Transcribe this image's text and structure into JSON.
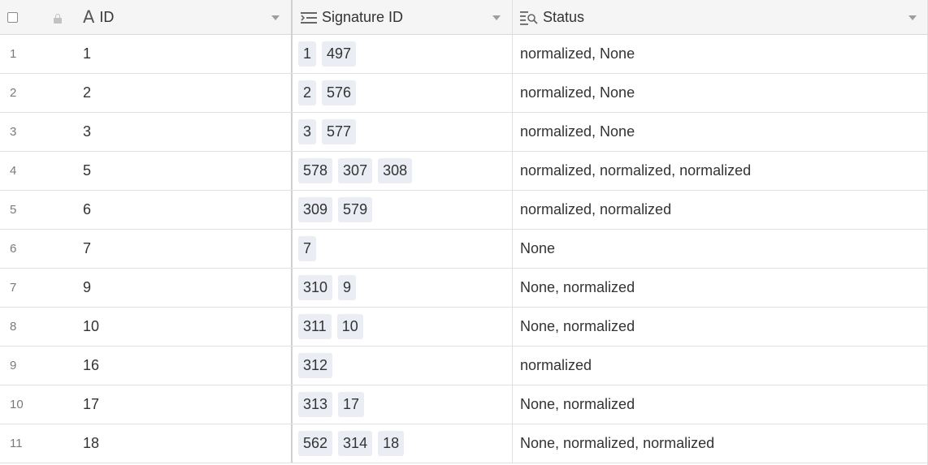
{
  "columns": {
    "id": {
      "label": "ID",
      "icon": "text-type-icon"
    },
    "signature_id": {
      "label": "Signature ID",
      "icon": "link-list-icon"
    },
    "status": {
      "label": "Status",
      "icon": "lookup-icon"
    }
  },
  "rows": [
    {
      "num": "1",
      "id": "1",
      "signatures": [
        "1",
        "497"
      ],
      "status": "normalized, None"
    },
    {
      "num": "2",
      "id": "2",
      "signatures": [
        "2",
        "576"
      ],
      "status": "normalized, None"
    },
    {
      "num": "3",
      "id": "3",
      "signatures": [
        "3",
        "577"
      ],
      "status": "normalized, None"
    },
    {
      "num": "4",
      "id": "5",
      "signatures": [
        "578",
        "307",
        "308"
      ],
      "status": "normalized, normalized, normalized"
    },
    {
      "num": "5",
      "id": "6",
      "signatures": [
        "309",
        "579"
      ],
      "status": "normalized, normalized"
    },
    {
      "num": "6",
      "id": "7",
      "signatures": [
        "7"
      ],
      "status": "None"
    },
    {
      "num": "7",
      "id": "9",
      "signatures": [
        "310",
        "9"
      ],
      "status": "None, normalized"
    },
    {
      "num": "8",
      "id": "10",
      "signatures": [
        "311",
        "10"
      ],
      "status": "None, normalized"
    },
    {
      "num": "9",
      "id": "16",
      "signatures": [
        "312"
      ],
      "status": "normalized"
    },
    {
      "num": "10",
      "id": "17",
      "signatures": [
        "313",
        "17"
      ],
      "status": "None, normalized"
    },
    {
      "num": "11",
      "id": "18",
      "signatures": [
        "562",
        "314",
        "18"
      ],
      "status": "None, normalized, normalized"
    }
  ],
  "colors": {
    "chip_bg": "#eaedf4",
    "header_bg": "#f5f5f5",
    "grid_line": "#e0e0e0"
  }
}
